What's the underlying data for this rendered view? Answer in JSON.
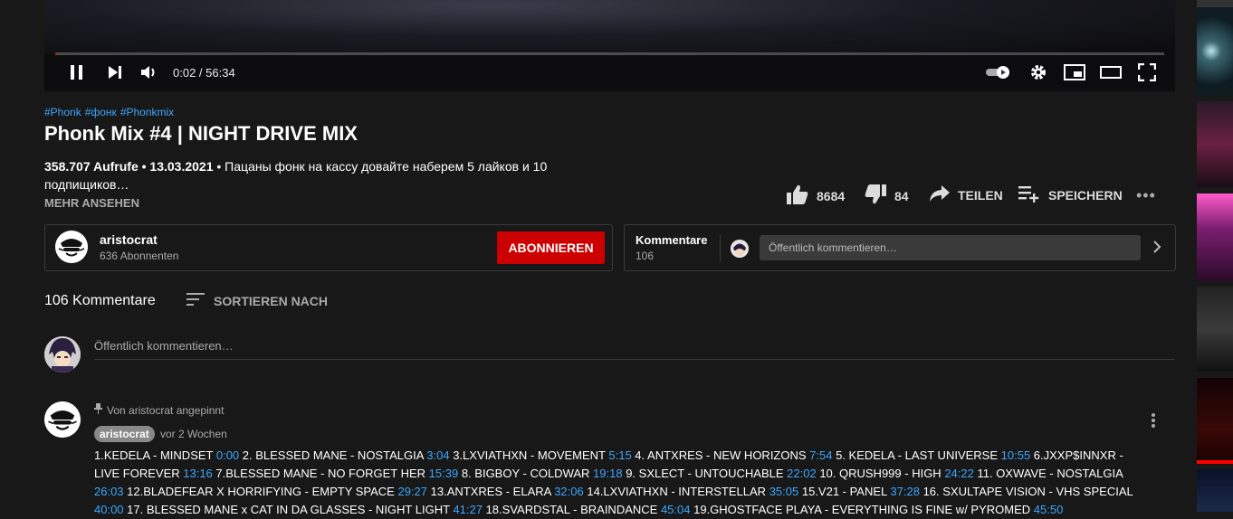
{
  "player": {
    "time_display": "0:02 / 56:34",
    "progress": 0.0006,
    "accent": "#ff0000"
  },
  "video": {
    "hashtags": [
      "#Phonk",
      "#фонк",
      "#Phonkmix"
    ],
    "title": "Phonk Mix #4 | NIGHT DRIVE MIX",
    "views_date": "358.707 Aufrufe • 13.03.2021",
    "description_snippet": " • Пацаны фонк на кассу довайте наберем 5 лайков и 10 подпищиков…",
    "show_more": "MEHR ANSEHEN"
  },
  "actions": {
    "likes": "8684",
    "dislikes": "84",
    "share": "TEILEN",
    "save": "SPEICHERN",
    "more": "•••"
  },
  "channel": {
    "name": "aristocrat",
    "subscribers": "636 Abonnenten",
    "subscribe_label": "ABONNIEREN",
    "subscribe_color": "#cc0000"
  },
  "comments_box": {
    "title": "Kommentare",
    "count": "106",
    "placeholder": "Öffentlich kommentieren…"
  },
  "comments": {
    "count_label": "106 Kommentare",
    "sort_label": "SORTIEREN NACH",
    "add_placeholder": "Öffentlich kommentieren…",
    "pinned": {
      "pinned_label": "Von aristocrat angepinnt",
      "author": "aristocrat",
      "time_ago": "vor 2 Wochen",
      "tracklist": [
        {
          "t": "1.KEDELA - MINDSET ",
          "ts": "0:00"
        },
        {
          "t": " 2. BLESSED MANE - NOSTALGIA ",
          "ts": "3:04"
        },
        {
          "t": " 3.LXVIATHXN - MOVEMENT ",
          "ts": "5:15"
        },
        {
          "t": " 4. ANTXRES - NEW HORIZONS ",
          "ts": "7:54"
        },
        {
          "t": " 5. KEDELA - LAST UNIVERSE ",
          "ts": "10:55"
        },
        {
          "t": " 6.JXXP$INNXR - LIVE FOREVER ",
          "ts": "13:16"
        },
        {
          "t": " 7.BLESSED MANE - NO FORGET HER ",
          "ts": "15:39"
        },
        {
          "t": " 8. BIGBOY - COLDWAR ",
          "ts": "19:18"
        },
        {
          "t": " 9. SXLECT - UNTOUCHABLE ",
          "ts": "22:02"
        },
        {
          "t": " 10. QRUSH999 - HIGH ",
          "ts": "24:22"
        },
        {
          "t": " 11. OXWAVE - NOSTALGIA ",
          "ts": "26:03"
        },
        {
          "t": " 12.BLADEFEAR X HORRIFYING - EMPTY SPACE ",
          "ts": "29:27"
        },
        {
          "t": " 13.ANTXRES - ELARA ",
          "ts": "32:06"
        },
        {
          "t": " 14.LXVIATHXN - INTERSTELLAR ",
          "ts": "35:05"
        },
        {
          "t": " 15.V21 - PANEL ",
          "ts": "37:28"
        },
        {
          "t": " 16. SXULTAPE VISION - VHS SPECIAL ",
          "ts": "40:00"
        },
        {
          "t": " 17. BLESSED MANE x CAT IN DA GLASSES - NIGHT LIGHT ",
          "ts": "41:27"
        },
        {
          "t": " 18.SVARDSTAL - BRAINDANCE ",
          "ts": "45:04"
        },
        {
          "t": " 19.GHOSTFACE PLAYA - EVERYTHING IS FINE w/ PYROMED ",
          "ts": "45:50"
        }
      ]
    }
  },
  "link_color": "#3ea6ff"
}
